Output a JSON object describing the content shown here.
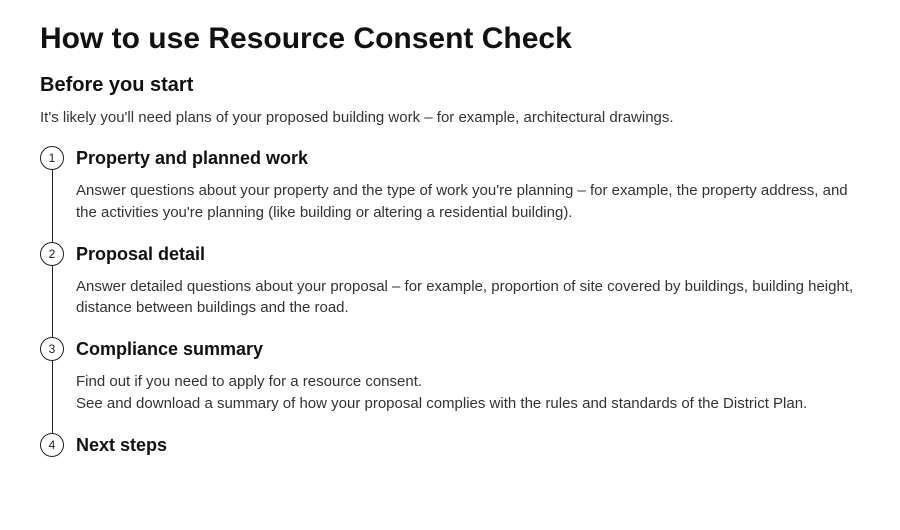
{
  "title": "How to use Resource Consent Check",
  "before_heading": "Before you start",
  "before_body": "It's likely you'll need plans of your proposed building work – for example, architectural drawings.",
  "steps": [
    {
      "num": "1",
      "title": "Property and planned work",
      "body": "Answer questions about your property and the type of work you're planning – for example, the property address, and the activities you're planning (like building or altering a residential building)."
    },
    {
      "num": "2",
      "title": "Proposal detail",
      "body": "Answer detailed questions about your proposal – for example, proportion of site covered by buildings, building height, distance between buildings and the road."
    },
    {
      "num": "3",
      "title": "Compliance summary",
      "body": "Find out if you need to apply for a resource consent.\nSee and download a summary of how your proposal complies with the rules and standards of the District Plan."
    },
    {
      "num": "4",
      "title": "Next steps",
      "body": ""
    }
  ]
}
